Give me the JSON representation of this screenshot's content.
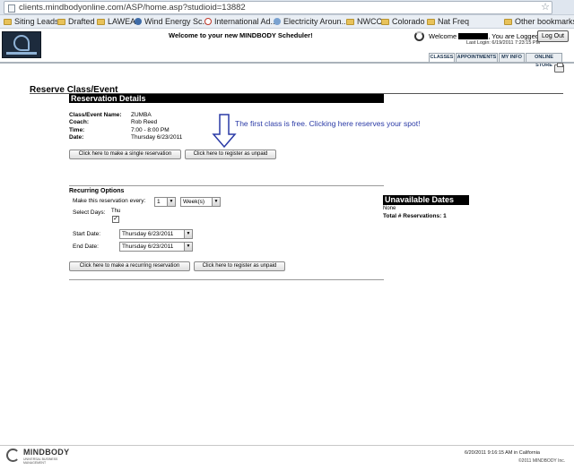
{
  "browser": {
    "url": "clients.mindbodyonline.com/ASP/home.asp?studioid=13882",
    "bookmarks": [
      "Siting Leads",
      "Drafted",
      "LAWEA",
      "Wind Energy Sc...",
      "International Ad...",
      "Electricity Aroun...",
      "NWCC",
      "Colorado",
      "Nat Freq"
    ],
    "other_bookmarks": "Other bookmarks"
  },
  "header": {
    "welcome_banner": "Welcome to your new MINDBODY Scheduler!",
    "welcome": "Welcome",
    "logged_in": ", You are Logged In",
    "last_login": "Last Login: 6/19/2011 7:23:15 PM",
    "logout": "Log Out",
    "tabs": [
      "CLASSES",
      "APPOINTMENTS",
      "MY INFO",
      "ONLINE STORE"
    ]
  },
  "main": {
    "title": "Reserve Class/Event",
    "section_title": "Reservation Details",
    "details": {
      "class_label": "Class/Event Name:",
      "class_value": "ZUMBA",
      "coach_label": "Coach:",
      "coach_value": "Rob Reed",
      "time_label": "Time:",
      "time_value": "7:00 - 8:00 PM",
      "date_label": "Date:",
      "date_value": "Thursday 6/23/2011"
    },
    "callout": "The first class is free.  Clicking here reserves your spot!",
    "single_button": "Click here to make a single reservation",
    "unpaid_button": "Click here to register as unpaid",
    "recurring": {
      "title": "Recurring Options",
      "every_label": "Make this reservation every:",
      "every_count": "1",
      "every_unit": "Week(s)",
      "select_days_label": "Select Days:",
      "day": "Thu",
      "day_checked": "✓",
      "start_label": "Start Date:",
      "start_value": "Thursday 6/23/2011",
      "end_label": "End Date:",
      "end_value": "Thursday 6/23/2011",
      "recurring_button": "Click here to make a recurring reservation",
      "unpaid_button": "Click here to register as unpaid"
    },
    "unavailable": {
      "title": "Unavailable Dates",
      "none": "None",
      "total": "Total # Reservations: 1"
    }
  },
  "footer": {
    "brand": "MINDBODY",
    "tagline": "UNIVERSAL BUSINESS MANAGEMENT",
    "timestamp": "6/20/2011 9:16:15 AM in California",
    "copyright": "©2011 MINDBODY Inc."
  }
}
